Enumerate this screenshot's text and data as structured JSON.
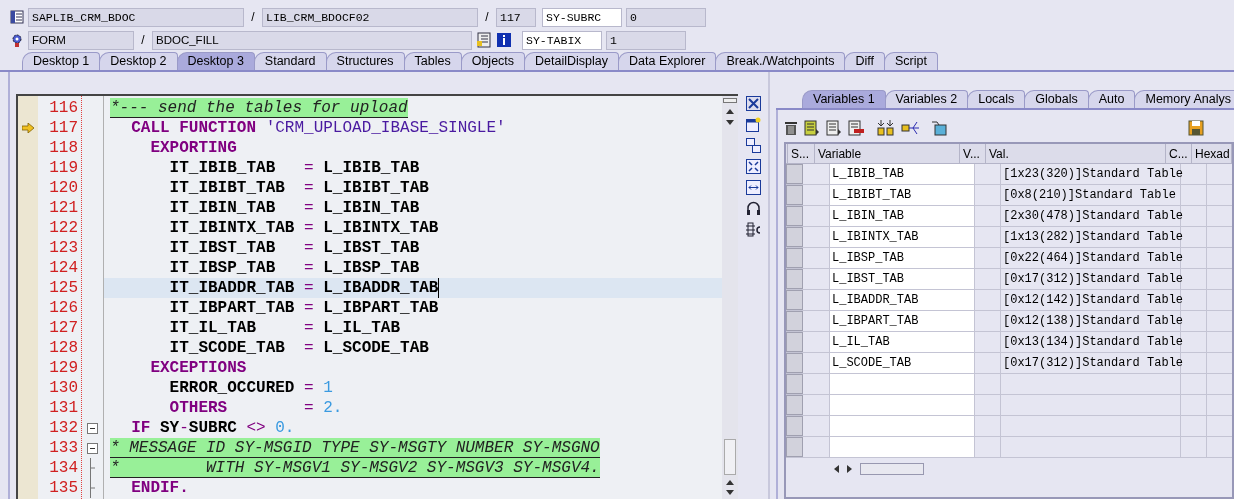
{
  "header": {
    "program": "SAPLIB_CRM_BDOC",
    "include": "LIB_CRM_BDOCF02",
    "line": "117",
    "event_type": "FORM",
    "event": "BDOC_FILL",
    "separators": [
      "/",
      "/",
      "/"
    ],
    "watch": [
      {
        "name": "SY-SUBRC",
        "value": "0"
      },
      {
        "name": "SY-TABIX",
        "value": "1"
      }
    ]
  },
  "desktop_tabs": [
    {
      "label": "Desktop 1",
      "selected": false
    },
    {
      "label": "Desktop 2",
      "selected": false
    },
    {
      "label": "Desktop 3",
      "selected": true
    },
    {
      "label": "Standard",
      "selected": false
    },
    {
      "label": "Structures",
      "selected": false
    },
    {
      "label": "Tables",
      "selected": false
    },
    {
      "label": "Objects",
      "selected": false
    },
    {
      "label": "DetailDisplay",
      "selected": false
    },
    {
      "label": "Data Explorer",
      "selected": false
    },
    {
      "label": "Break./Watchpoints",
      "selected": false
    },
    {
      "label": "Diff",
      "selected": false
    },
    {
      "label": "Script",
      "selected": false
    }
  ],
  "editor": {
    "lines": [
      {
        "number": "116",
        "current": false,
        "cursor": false,
        "fold_box": false,
        "tokens": [
          {
            "kind": "comment",
            "text": "*--- send the tables for upload"
          }
        ]
      },
      {
        "number": "117",
        "current": true,
        "cursor": false,
        "fold_box": false,
        "tokens": [
          {
            "kind": "keyword",
            "text": "  CALL FUNCTION "
          },
          {
            "kind": "string",
            "text": "'CRM_UPLOAD_IBASE_SINGLE'"
          }
        ]
      },
      {
        "number": "118",
        "current": false,
        "cursor": false,
        "fold_box": false,
        "tokens": [
          {
            "kind": "keyword",
            "text": "    EXPORTING"
          }
        ]
      },
      {
        "number": "119",
        "current": false,
        "cursor": false,
        "fold_box": false,
        "tokens": [
          {
            "kind": "plain",
            "text": "      IT_IBIB_TAB   "
          },
          {
            "kind": "operator",
            "text": "="
          },
          {
            "kind": "plain",
            "text": " L_IBIB_TAB"
          }
        ]
      },
      {
        "number": "120",
        "current": false,
        "cursor": false,
        "fold_box": false,
        "tokens": [
          {
            "kind": "plain",
            "text": "      IT_IBIBT_TAB  "
          },
          {
            "kind": "operator",
            "text": "="
          },
          {
            "kind": "plain",
            "text": " L_IBIBT_TAB"
          }
        ]
      },
      {
        "number": "121",
        "current": false,
        "cursor": false,
        "fold_box": false,
        "tokens": [
          {
            "kind": "plain",
            "text": "      IT_IBIN_TAB   "
          },
          {
            "kind": "operator",
            "text": "="
          },
          {
            "kind": "plain",
            "text": " L_IBIN_TAB"
          }
        ]
      },
      {
        "number": "122",
        "current": false,
        "cursor": false,
        "fold_box": false,
        "tokens": [
          {
            "kind": "plain",
            "text": "      IT_IBINTX_TAB "
          },
          {
            "kind": "operator",
            "text": "="
          },
          {
            "kind": "plain",
            "text": " L_IBINTX_TAB"
          }
        ]
      },
      {
        "number": "123",
        "current": false,
        "cursor": false,
        "fold_box": false,
        "tokens": [
          {
            "kind": "plain",
            "text": "      IT_IBST_TAB   "
          },
          {
            "kind": "operator",
            "text": "="
          },
          {
            "kind": "plain",
            "text": " L_IBST_TAB"
          }
        ]
      },
      {
        "number": "124",
        "current": false,
        "cursor": false,
        "fold_box": false,
        "tokens": [
          {
            "kind": "plain",
            "text": "      IT_IBSP_TAB   "
          },
          {
            "kind": "operator",
            "text": "="
          },
          {
            "kind": "plain",
            "text": " L_IBSP_TAB"
          }
        ]
      },
      {
        "number": "125",
        "current": false,
        "cursor": true,
        "fold_box": false,
        "tokens": [
          {
            "kind": "plain",
            "text": "      IT_IBADDR_TAB "
          },
          {
            "kind": "operator",
            "text": "="
          },
          {
            "kind": "plain",
            "text": " L_IBADDR_TAB"
          }
        ]
      },
      {
        "number": "126",
        "current": false,
        "cursor": false,
        "fold_box": false,
        "tokens": [
          {
            "kind": "plain",
            "text": "      IT_IBPART_TAB "
          },
          {
            "kind": "operator",
            "text": "="
          },
          {
            "kind": "plain",
            "text": " L_IBPART_TAB"
          }
        ]
      },
      {
        "number": "127",
        "current": false,
        "cursor": false,
        "fold_box": false,
        "tokens": [
          {
            "kind": "plain",
            "text": "      IT_IL_TAB     "
          },
          {
            "kind": "operator",
            "text": "="
          },
          {
            "kind": "plain",
            "text": " L_IL_TAB"
          }
        ]
      },
      {
        "number": "128",
        "current": false,
        "cursor": false,
        "fold_box": false,
        "tokens": [
          {
            "kind": "plain",
            "text": "      IT_SCODE_TAB  "
          },
          {
            "kind": "operator",
            "text": "="
          },
          {
            "kind": "plain",
            "text": " L_SCODE_TAB"
          }
        ]
      },
      {
        "number": "129",
        "current": false,
        "cursor": false,
        "fold_box": false,
        "tokens": [
          {
            "kind": "keyword",
            "text": "    EXCEPTIONS"
          }
        ]
      },
      {
        "number": "130",
        "current": false,
        "cursor": false,
        "fold_box": false,
        "tokens": [
          {
            "kind": "plain",
            "text": "      ERROR_OCCURED "
          },
          {
            "kind": "operator",
            "text": "= "
          },
          {
            "kind": "number",
            "text": "1"
          }
        ]
      },
      {
        "number": "131",
        "current": false,
        "cursor": false,
        "fold_box": false,
        "tokens": [
          {
            "kind": "keyword",
            "text": "      OTHERS        "
          },
          {
            "kind": "operator",
            "text": "= "
          },
          {
            "kind": "number",
            "text": "2."
          }
        ]
      },
      {
        "number": "132",
        "current": false,
        "cursor": false,
        "fold_box": true,
        "tokens": [
          {
            "kind": "keyword",
            "text": "  IF "
          },
          {
            "kind": "plain",
            "text": "SY"
          },
          {
            "kind": "operator",
            "text": "-"
          },
          {
            "kind": "plain",
            "text": "SUBRC "
          },
          {
            "kind": "operator",
            "text": "<> "
          },
          {
            "kind": "number",
            "text": "0."
          }
        ]
      },
      {
        "number": "133",
        "current": false,
        "cursor": false,
        "fold_box": true,
        "tokens": [
          {
            "kind": "comment",
            "text": "* MESSAGE ID SY-MSGID TYPE SY-MSGTY NUMBER SY-MSGNO"
          }
        ]
      },
      {
        "number": "134",
        "current": false,
        "cursor": false,
        "fold_box": false,
        "tokens": [
          {
            "kind": "comment",
            "text": "*         WITH SY-MSGV1 SY-MSGV2 SY-MSGV3 SY-MSGV4."
          }
        ]
      },
      {
        "number": "135",
        "current": false,
        "cursor": false,
        "fold_box": false,
        "tokens": [
          {
            "kind": "keyword",
            "text": "  ENDIF."
          }
        ]
      }
    ]
  },
  "variable_tabs": [
    {
      "label": "Variables 1",
      "selected": true
    },
    {
      "label": "Variables 2",
      "selected": false
    },
    {
      "label": "Locals",
      "selected": false
    },
    {
      "label": "Globals",
      "selected": false
    },
    {
      "label": "Auto",
      "selected": false
    },
    {
      "label": "Memory Analys",
      "selected": false
    }
  ],
  "table": {
    "columns": [
      "S...",
      "Variable",
      "V...",
      "Val.",
      "C...",
      "Hexad"
    ],
    "rows": [
      {
        "variable": "L_IBIB_TAB",
        "value": "[1x23(320)]Standard Table"
      },
      {
        "variable": "L_IBIBT_TAB",
        "value": "[0x8(210)]Standard Table"
      },
      {
        "variable": "L_IBIN_TAB",
        "value": "[2x30(478)]Standard Table"
      },
      {
        "variable": "L_IBINTX_TAB",
        "value": "[1x13(282)]Standard Table"
      },
      {
        "variable": "L_IBSP_TAB",
        "value": "[0x22(464)]Standard Table"
      },
      {
        "variable": "L_IBST_TAB",
        "value": "[0x17(312)]Standard Table"
      },
      {
        "variable": "L_IBADDR_TAB",
        "value": "[0x12(142)]Standard Table"
      },
      {
        "variable": "L_IBPART_TAB",
        "value": "[0x12(138)]Standard Table"
      },
      {
        "variable": "L_IL_TAB",
        "value": "[0x13(134)]Standard Table"
      },
      {
        "variable": "L_SCODE_TAB",
        "value": "[0x17(312)]Standard Table"
      }
    ]
  }
}
